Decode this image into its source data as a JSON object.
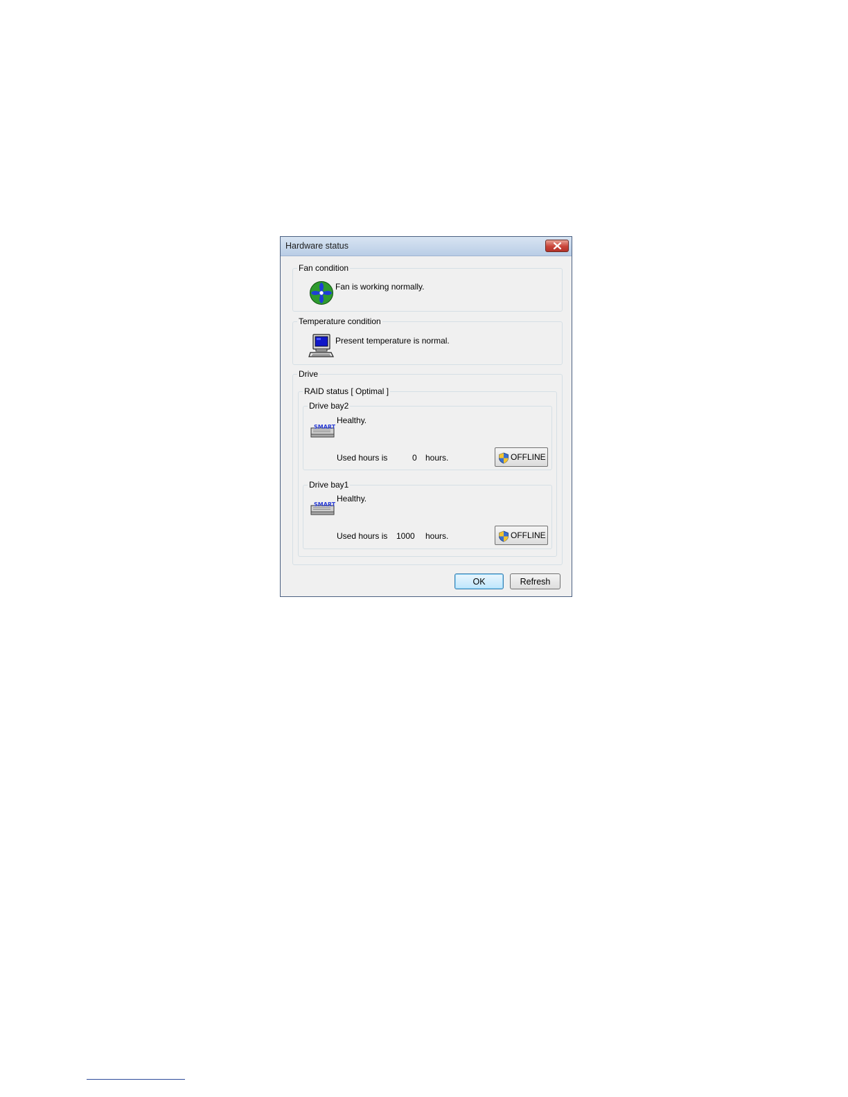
{
  "window": {
    "title": "Hardware status"
  },
  "fan": {
    "legend": "Fan condition",
    "message": "Fan is working normally.",
    "icon": "fan-icon"
  },
  "temperature": {
    "legend": "Temperature condition",
    "message": "Present temperature is normal.",
    "icon": "computer-icon"
  },
  "drive": {
    "legend": "Drive",
    "raid_legend": "RAID status [ Optimal ]",
    "bays": [
      {
        "name": "Drive bay2",
        "status": "Healthy.",
        "used_label": "Used hours is",
        "hours": "0",
        "hours_unit": "hours.",
        "offline_label": "OFFLINE"
      },
      {
        "name": "Drive bay1",
        "status": "Healthy.",
        "used_label": "Used hours is",
        "hours": "1000",
        "hours_unit": "hours.",
        "offline_label": "OFFLINE"
      }
    ]
  },
  "buttons": {
    "ok": "OK",
    "refresh": "Refresh"
  },
  "colors": {
    "titlebar": "#c8d8ec",
    "close_button": "#c9453a",
    "dialog_bg": "#f0f0f0",
    "fan_blade": "#1e3fd6",
    "fan_ring": "#2e9a2e"
  }
}
